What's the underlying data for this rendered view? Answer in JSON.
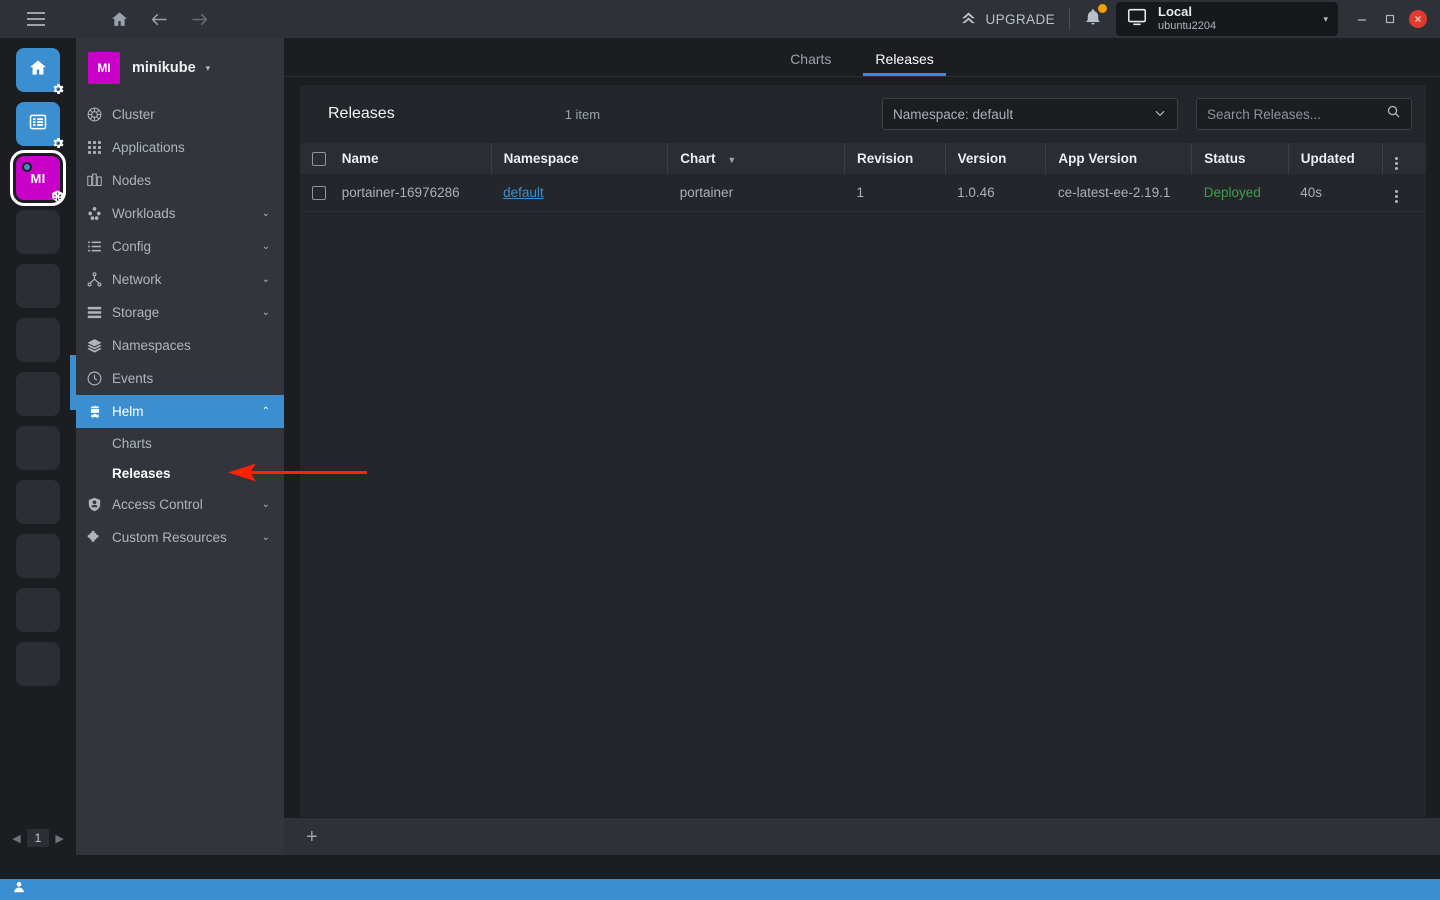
{
  "titlebar": {
    "hamburger_icon": "hamburger-icon",
    "home_icon": "home-icon",
    "back_icon": "arrow-left-icon",
    "forward_icon": "arrow-right-icon",
    "upgrade_label": "UPGRADE",
    "upgrade_icon": "chevron-double-up-icon",
    "bell_icon": "bell-icon",
    "env": {
      "icon": "monitor-icon",
      "name": "Local",
      "subtitle": "ubuntu2204",
      "caret": "▾"
    },
    "window": {
      "minimize": "–",
      "maximize": "▫",
      "close": "✕"
    }
  },
  "rail": {
    "items": [
      {
        "name": "home-environment",
        "kind": "blue",
        "icon": "home-icon",
        "badge": "gear-icon",
        "selected": false,
        "initials": ""
      },
      {
        "name": "list-environment",
        "kind": "blue",
        "icon": "list-icon",
        "badge": "gear-icon",
        "selected": false,
        "initials": ""
      },
      {
        "name": "minikube-environment",
        "kind": "magenta",
        "icon": "",
        "badge": "kubernetes-icon",
        "selected": true,
        "initials": "MI"
      },
      {
        "name": "rail-placeholder-1",
        "kind": "empty",
        "icon": "",
        "badge": "",
        "selected": false,
        "initials": ""
      },
      {
        "name": "rail-placeholder-2",
        "kind": "empty",
        "icon": "",
        "badge": "",
        "selected": false,
        "initials": ""
      },
      {
        "name": "rail-placeholder-3",
        "kind": "empty",
        "icon": "",
        "badge": "",
        "selected": false,
        "initials": ""
      },
      {
        "name": "rail-placeholder-4",
        "kind": "empty",
        "icon": "",
        "badge": "",
        "selected": false,
        "initials": ""
      },
      {
        "name": "rail-placeholder-5",
        "kind": "empty",
        "icon": "",
        "badge": "",
        "selected": false,
        "initials": ""
      },
      {
        "name": "rail-placeholder-6",
        "kind": "empty",
        "icon": "",
        "badge": "",
        "selected": false,
        "initials": ""
      },
      {
        "name": "rail-placeholder-7",
        "kind": "empty",
        "icon": "",
        "badge": "",
        "selected": false,
        "initials": ""
      },
      {
        "name": "rail-placeholder-8",
        "kind": "empty",
        "icon": "",
        "badge": "",
        "selected": false,
        "initials": ""
      },
      {
        "name": "rail-placeholder-9",
        "kind": "empty",
        "icon": "",
        "badge": "",
        "selected": false,
        "initials": ""
      }
    ],
    "pager": {
      "prev": "◀",
      "page": "1",
      "next": "▶"
    }
  },
  "sidebar": {
    "cluster": {
      "initials": "MI",
      "name": "minikube",
      "caret": "▾"
    },
    "items": [
      {
        "label": "Cluster",
        "icon": "helm-wheel-icon",
        "chevron": "",
        "active": false
      },
      {
        "label": "Applications",
        "icon": "grid-icon",
        "chevron": "",
        "active": false
      },
      {
        "label": "Nodes",
        "icon": "nodes-icon",
        "chevron": "",
        "active": false
      },
      {
        "label": "Workloads",
        "icon": "workloads-icon",
        "chevron": "⌄",
        "active": false
      },
      {
        "label": "Config",
        "icon": "config-list-icon",
        "chevron": "⌄",
        "active": false
      },
      {
        "label": "Network",
        "icon": "network-icon",
        "chevron": "⌄",
        "active": false
      },
      {
        "label": "Storage",
        "icon": "storage-icon",
        "chevron": "⌄",
        "active": false
      },
      {
        "label": "Namespaces",
        "icon": "layers-icon",
        "chevron": "",
        "active": false
      },
      {
        "label": "Events",
        "icon": "clock-icon",
        "chevron": "",
        "active": false
      },
      {
        "label": "Helm",
        "icon": "helm-icon",
        "chevron": "⌃",
        "active": true
      }
    ],
    "helm_children": [
      {
        "label": "Charts",
        "current": false
      },
      {
        "label": "Releases",
        "current": true
      }
    ],
    "items_after": [
      {
        "label": "Access Control",
        "icon": "shield-icon",
        "chevron": "⌄",
        "active": false
      },
      {
        "label": "Custom Resources",
        "icon": "puzzle-icon",
        "chevron": "⌄",
        "active": false
      }
    ]
  },
  "main": {
    "tabs": [
      {
        "label": "Charts",
        "selected": false
      },
      {
        "label": "Releases",
        "selected": true
      }
    ],
    "panel": {
      "title": "Releases",
      "title_icon": "helm-icon",
      "count": "1 item",
      "namespace_select": {
        "value": "Namespace: default",
        "caret": "⌄"
      },
      "search": {
        "placeholder": "Search Releases...",
        "value": "",
        "icon": "search-icon"
      },
      "columns": [
        {
          "label": "Name",
          "sorted": false
        },
        {
          "label": "Namespace",
          "sorted": false
        },
        {
          "label": "Chart",
          "sorted": true
        },
        {
          "label": "Revision",
          "sorted": false
        },
        {
          "label": "Version",
          "sorted": false
        },
        {
          "label": "App Version",
          "sorted": false
        },
        {
          "label": "Status",
          "sorted": false
        },
        {
          "label": "Updated",
          "sorted": false
        }
      ],
      "rows": [
        {
          "name": "portainer-16976286 ",
          "namespace": "default",
          "chart": "portainer",
          "revision": "1",
          "version": "1.0.46",
          "app_version": "ce-latest-ee-2.19.1",
          "status": "Deployed",
          "updated": "40s"
        }
      ]
    },
    "add_button": "+"
  },
  "colors": {
    "accent": "#3b8fd0",
    "magenta": "#c800c8",
    "status_ok": "#3f9e4d",
    "annotation": "#ff2200",
    "panel_bg": "#23262b",
    "sidebar_bg": "#32363c"
  }
}
